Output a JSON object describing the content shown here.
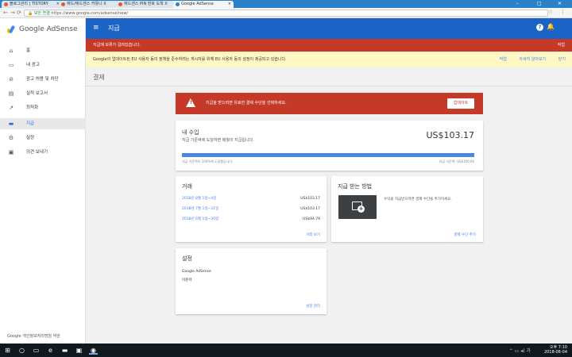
{
  "browser": {
    "tabs": [
      {
        "label": "블로그관리 | TISTORY"
      },
      {
        "label": "애드/애드센스 커뮤니 X"
      },
      {
        "label": "애드센스 PIN 번호 도착 X"
      },
      {
        "label": "Google AdSense"
      }
    ],
    "address": {
      "secure_label": "보안 연결",
      "url": "https://www.google.com/adsense/new/"
    }
  },
  "sidebar": {
    "logo_text": "Google AdSense",
    "items": [
      {
        "label": "홈",
        "icon": "home-icon"
      },
      {
        "label": "내 광고",
        "icon": "ads-icon"
      },
      {
        "label": "광고 허용 및 차단",
        "icon": "block-icon"
      },
      {
        "label": "실적 보고서",
        "icon": "report-icon"
      },
      {
        "label": "최적화",
        "icon": "trending-icon"
      },
      {
        "label": "지급",
        "icon": "payments-icon",
        "selected": true
      },
      {
        "label": "설정",
        "icon": "gear-icon"
      },
      {
        "label": "의견 보내기",
        "icon": "feedback-icon"
      }
    ],
    "footer": "Google  개인정보처리방침  약관"
  },
  "topbar": {
    "title": "지급",
    "help": "?"
  },
  "red_banner": {
    "text": "지급에 보류가 걸려있습니다.",
    "action": "작업"
  },
  "yellow_banner": {
    "text": "Google의 업데이트된 EU 사용자 동의 정책을 준수하려는 게시자를 위해 EU 사용자 동의 설정이 제공되고 있습니다.",
    "links": [
      "작업",
      "자세히 알아보기",
      "닫기"
    ]
  },
  "page_title": "결제",
  "alert": {
    "text": "지급을 받으려면 유효한 결제 수단을 선택하세요.",
    "button": "업데이트"
  },
  "earnings": {
    "title": "내 수입",
    "subtitle": "지급 기준액에 도달하면 매월이 지급됩니다.",
    "amount": "US$103.17",
    "progress": 1.0,
    "left_label": "지급 기준액의 100%에 도달했습니다.",
    "right_label": "지급 기준액: US$100.00"
  },
  "transactions": {
    "title": "거래",
    "rows": [
      {
        "date": "2018년 8월 1일~4일",
        "value": "US$103.17"
      },
      {
        "date": "2018년 7월 1일~31일",
        "value": "US$103.17"
      },
      {
        "date": "2018년 6월 1일~30일",
        "value": "US$94.79"
      }
    ],
    "footer": "거래 보기"
  },
  "payment": {
    "title": "지급 받는 방법",
    "desc": "수익을 지급받으려면 결제 수단을 추가하세요.",
    "footer": "결제 수단 추가"
  },
  "settings": {
    "title": "설정",
    "line1": "Google AdSense",
    "line2": "이준학",
    "footer": "설정 관리"
  },
  "tray": {
    "time": "오후 7:10",
    "date": "2018-08-04"
  }
}
